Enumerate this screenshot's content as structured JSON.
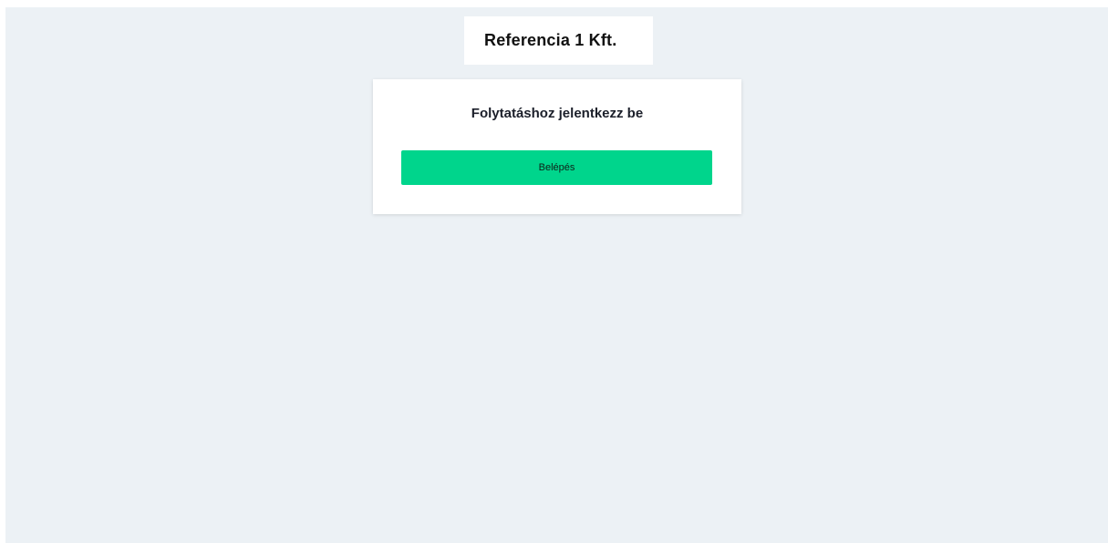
{
  "header": {
    "company_name": "Referencia 1 Kft."
  },
  "login_card": {
    "heading": "Folytatáshoz jelentkezz be",
    "login_button_label": "Belépés"
  },
  "colors": {
    "background": "#ecf1f5",
    "card": "#ffffff",
    "accent_button": "#00d58c"
  }
}
